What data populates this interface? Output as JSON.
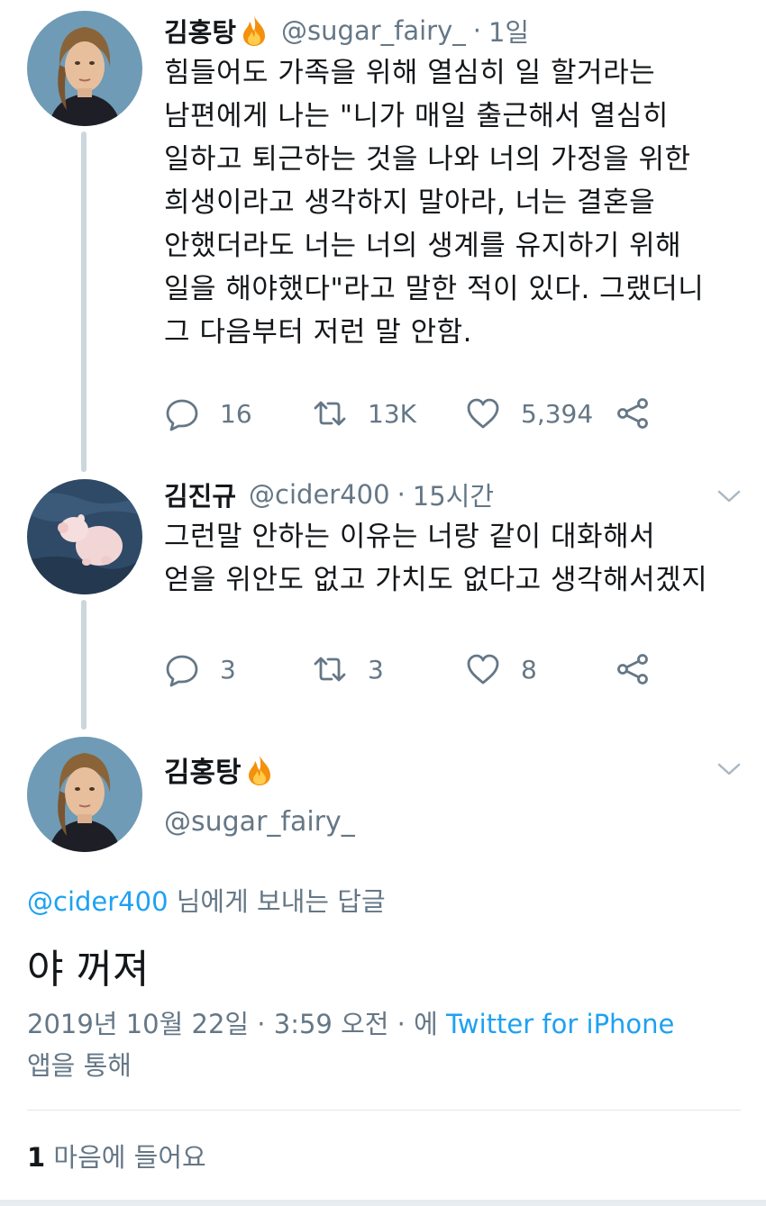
{
  "tweets": [
    {
      "name": "김홍탕",
      "handle": "@sugar_fairy_",
      "dot": "·",
      "time": "1일",
      "text": "힘들어도 가족을 위해 열심히 일 할거라는\n남편에게 나는 \"니가 매일 출근해서 열심히\n일하고 퇴근하는 것을 나와 너의 가정을 위한\n희생이라고 생각하지 말아라, 너는 결혼을\n안했더라도 너는 너의 생계를 유지하기 위해\n일을 해야했다\"라고 말한 적이 있다. 그랬더니\n그 다음부터 저런 말 안함.",
      "replies": "16",
      "retweets": "13K",
      "likes": "5,394"
    },
    {
      "name": "김진규",
      "handle": "@cider400",
      "dot": "·",
      "time": "15시간",
      "text": "그런말 안하는 이유는 너랑 같이 대화해서\n얻을 위안도 없고 가치도 없다고 생각해서겠지",
      "replies": "3",
      "retweets": "3",
      "likes": "8"
    }
  ],
  "main_tweet": {
    "name": "김홍탕",
    "handle": "@sugar_fairy_",
    "reply_mention": "@cider400",
    "reply_suffix": " 님에게 보내는 답글",
    "text": "야 꺼져",
    "timestamp": "2019년 10월 22일 · 3:59 오전 · 에 ",
    "source": "Twitter for iPhone",
    "source_suffix": "앱을 통해",
    "like_count": "1",
    "like_label": " 마음에 들어요"
  },
  "icons": {
    "reply": "reply-icon",
    "retweet": "retweet-icon",
    "like": "heart-icon",
    "share": "share-icon",
    "more": "chevron-down-icon",
    "emoji": "fire-emoji-icon"
  },
  "colors": {
    "accent": "#1da1f2",
    "secondary_text": "#657786",
    "primary_text": "#14171a",
    "thread_line": "#ccd6dd",
    "flame": "#f4900c"
  }
}
